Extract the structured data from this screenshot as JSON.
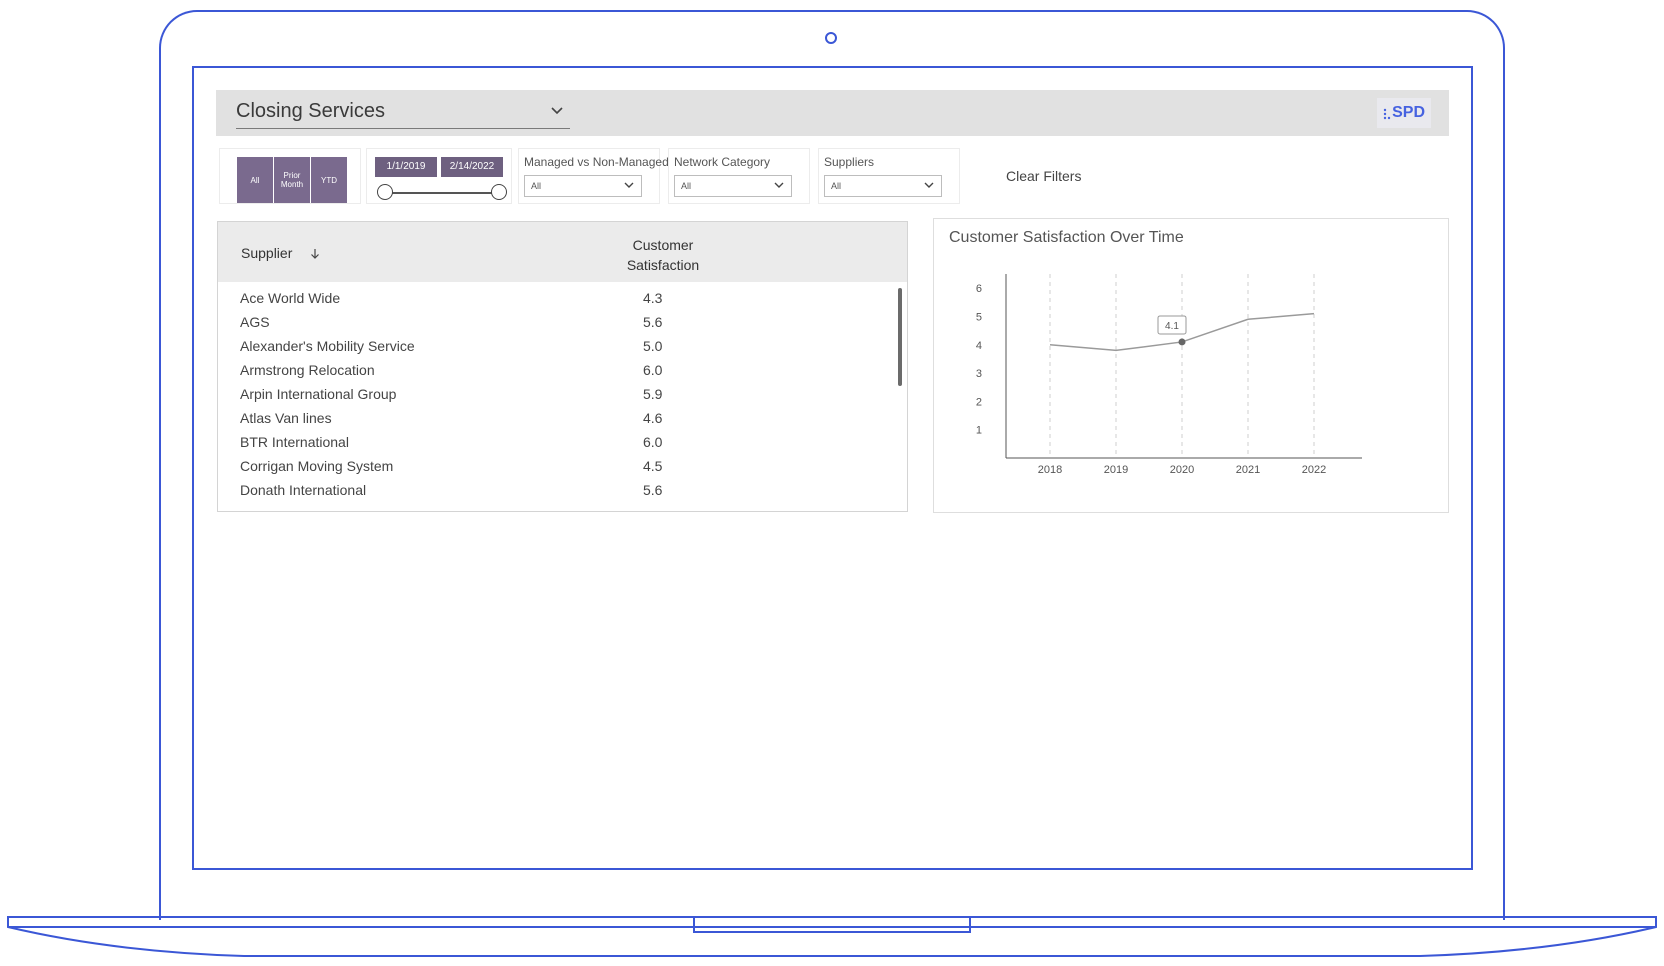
{
  "header": {
    "title": "Closing Services",
    "logo_text": "SPD"
  },
  "filters": {
    "period_buttons": [
      "All",
      "Prior Month",
      "YTD"
    ],
    "date_range": {
      "start": "1/1/2019",
      "end": "2/14/2022"
    },
    "dropdowns": [
      {
        "label": "Managed vs Non-Managed",
        "value": "All"
      },
      {
        "label": "Network Category",
        "value": "All"
      },
      {
        "label": "Suppliers",
        "value": "All"
      }
    ],
    "clear_label": "Clear Filters"
  },
  "table": {
    "headers": {
      "supplier": "Supplier",
      "score": "Customer Satisfaction"
    },
    "rows": [
      {
        "name": "Ace World Wide",
        "score": "4.3"
      },
      {
        "name": "AGS",
        "score": "5.6"
      },
      {
        "name": "Alexander's Mobility Service",
        "score": "5.0"
      },
      {
        "name": "Armstrong Relocation",
        "score": "6.0"
      },
      {
        "name": "Arpin International Group",
        "score": "5.9"
      },
      {
        "name": "Atlas Van lines",
        "score": "4.6"
      },
      {
        "name": "BTR International",
        "score": "6.0"
      },
      {
        "name": "Corrigan Moving System",
        "score": "4.5"
      },
      {
        "name": "Donath International",
        "score": "5.6"
      }
    ]
  },
  "chart_data": {
    "type": "line",
    "title": "Customer Satisfaction Over Time",
    "x": [
      "2018",
      "2019",
      "2020",
      "2021",
      "2022"
    ],
    "series": [
      {
        "values": [
          4.0,
          3.8,
          4.1,
          4.9,
          5.1
        ]
      }
    ],
    "ylim": [
      0,
      6.5
    ],
    "yticks": [
      1,
      2,
      3,
      4,
      5,
      6
    ],
    "grid": "vertical dashed",
    "tooltip": {
      "x": "2020",
      "label": "4.1"
    },
    "colors": {
      "line": "#9a9a9a",
      "point": "#666666"
    }
  },
  "colors": {
    "accent": "#3b57d6",
    "filter_purple": "#7a6a8e",
    "header_bg": "#e1e1e1"
  }
}
